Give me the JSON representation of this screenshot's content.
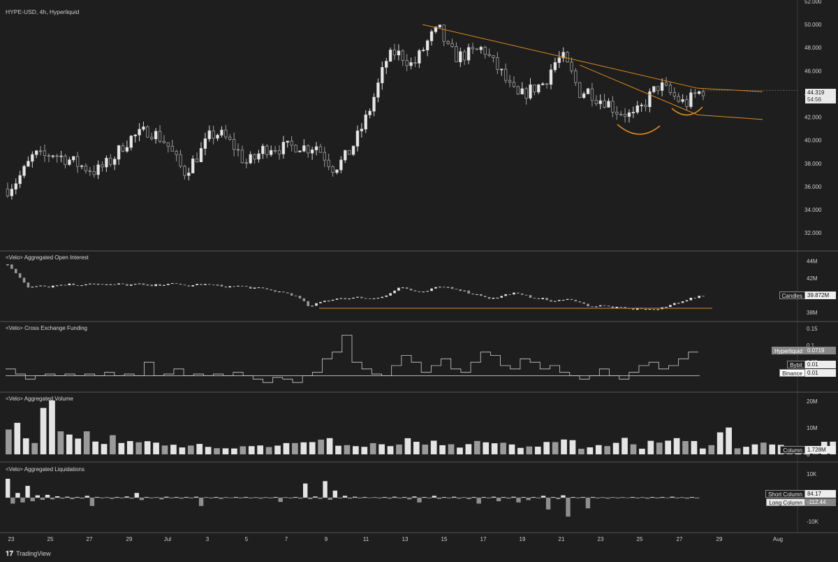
{
  "chart_data": [
    {
      "type": "candlestick",
      "title": "HYPE-USD, 4h, Hyperliquid",
      "ylim": [
        30.5,
        52
      ],
      "y_ticks": [
        "32.000",
        "34.000",
        "36.000",
        "38.000",
        "40.000",
        "42.000",
        "44.000",
        "46.000",
        "48.000",
        "50.000",
        "52.000"
      ],
      "last_price": "44.319",
      "countdown": "54:56",
      "close_path": [
        35.8,
        36.5,
        37.5,
        38.8,
        38.5,
        38.9,
        38.6,
        38.3,
        37.9,
        37.6,
        37.3,
        37.8,
        38.4,
        39.5,
        40.2,
        40.5,
        40.9,
        40.4,
        39.8,
        38.5,
        37.2,
        38.1,
        39.1,
        40.4,
        40.6,
        40.0,
        39.2,
        38.0,
        38.4,
        39.2,
        39.5,
        39.3,
        39.4,
        39.6,
        39.3,
        39.6,
        38.6,
        37.6,
        38.2,
        39.2,
        40.7,
        42.4,
        44.6,
        46.9,
        47.6,
        47.2,
        46.4,
        47.6,
        48.9,
        49.6,
        47.9,
        47.2,
        47.4,
        47.6,
        48.0,
        46.8,
        45.9,
        44.6,
        43.7,
        44.2,
        44.6,
        45.0,
        46.6,
        47.2,
        45.8,
        44.1,
        44.3,
        43.6,
        43.4,
        42.6,
        42.4,
        42.0,
        42.8,
        43.9,
        44.8,
        44.2,
        43.6,
        43.1,
        43.9,
        44.3
      ],
      "trendlines": [
        {
          "from": [
            "Jul 14",
            50.0
          ],
          "to": [
            "Jul 28",
            44.5
          ]
        },
        {
          "from": [
            "Jul 22",
            46.5
          ],
          "to": [
            "Jul 28",
            42.2
          ]
        }
      ]
    },
    {
      "type": "line",
      "title": "<Velo> Aggregated Open Interest",
      "y_ticks": [
        "38M",
        "40M",
        "42M",
        "44M"
      ],
      "ylim": [
        37.6,
        44.6
      ],
      "legend_label": "Candles",
      "legend_value": "39.872M",
      "support_level": 38.5,
      "values": [
        43.5,
        42.4,
        41.0,
        41.2,
        41.0,
        41.2,
        41.3,
        41.2,
        41.4,
        41.3,
        41.2,
        41.3,
        41.2,
        41.3,
        41.1,
        41.2,
        41.4,
        41.2,
        41.1,
        41.3,
        41.2,
        41.1,
        41.0,
        41.1,
        40.9,
        40.8,
        40.6,
        40.4,
        40.2,
        39.6,
        38.6,
        39.2,
        39.5,
        39.7,
        39.6,
        39.8,
        39.6,
        39.8,
        40.3,
        41.0,
        40.6,
        40.2,
        40.7,
        41.0,
        40.9,
        40.6,
        40.2,
        40.0,
        39.6,
        39.9,
        40.3,
        40.0,
        39.8,
        39.6,
        39.3,
        39.4,
        39.6,
        39.0,
        38.7,
        38.8,
        38.6,
        38.5,
        38.4,
        38.5,
        38.3,
        38.5,
        39.0,
        39.4,
        39.7,
        39.9
      ]
    },
    {
      "type": "step",
      "title": "<Velo> Cross Exchange Funding",
      "y_ticks": [
        "0.05",
        "0.1",
        "0.15"
      ],
      "ylim": [
        -0.02,
        0.16
      ],
      "series": [
        {
          "name": "Hyperliquid",
          "value": "0.0719",
          "values": [
            0.02,
            0.005,
            -0.01,
            0.0,
            0.005,
            0.0,
            0.005,
            0.0,
            0.005,
            0.0,
            0.01,
            0.0,
            0.005,
            0.0,
            0.04,
            0.0,
            0.005,
            0.02,
            0.0,
            0.005,
            0.0,
            0.005,
            0.0,
            0.01,
            0.0,
            -0.01,
            -0.02,
            -0.005,
            -0.01,
            -0.02,
            0.0,
            0.01,
            0.05,
            0.07,
            0.12,
            0.04,
            0.02,
            0.005,
            0.0,
            0.03,
            0.06,
            0.04,
            0.01,
            0.03,
            0.05,
            0.02,
            0.01,
            0.04,
            0.07,
            0.06,
            0.03,
            0.02,
            0.05,
            0.04,
            0.02,
            0.03,
            0.01,
            0.0,
            -0.01,
            0.0,
            0.02,
            0.0,
            -0.01,
            0.01,
            0.03,
            0.04,
            0.02,
            0.03,
            0.05,
            0.07
          ]
        },
        {
          "name": "Bybit",
          "value": "0.01"
        },
        {
          "name": "Binance",
          "value": "0.01"
        }
      ]
    },
    {
      "type": "bar",
      "title": "<Velo> Aggregated Volume",
      "y_ticks": [
        "0",
        "10M",
        "20M"
      ],
      "ylim": [
        0,
        21
      ],
      "legend_label": "Column",
      "legend_value": "1.728M",
      "values": [
        12,
        6,
        17,
        9,
        8,
        5,
        6,
        4,
        4,
        3,
        3,
        4,
        3,
        3,
        4,
        3,
        5,
        4,
        5,
        4,
        3,
        4,
        3,
        5,
        4,
        3,
        3,
        4,
        4,
        3,
        3,
        4,
        5,
        3,
        3,
        6,
        3,
        4,
        5,
        4,
        3,
        9,
        3,
        5,
        4,
        3,
        3,
        4,
        3,
        4,
        3,
        4,
        5,
        5,
        7,
        5,
        10,
        5,
        4,
        4,
        3,
        3,
        4,
        9,
        6,
        5,
        4,
        4,
        6,
        7,
        4,
        3,
        4,
        3,
        3,
        4,
        3,
        2,
        2,
        3
      ]
    },
    {
      "type": "bar",
      "title": "<Velo> Aggregated Liquidations",
      "y_ticks": [
        "10K",
        "-10K"
      ],
      "ylim": [
        -13000,
        13000
      ],
      "series": [
        {
          "name": "Short Column",
          "value": "84.17",
          "values": [
            8000,
            2000,
            5000,
            1000,
            1200,
            600,
            400,
            300,
            800,
            300,
            200,
            300,
            500,
            2000,
            300,
            200,
            400,
            300,
            300,
            400,
            200,
            300,
            200,
            300,
            300,
            200,
            200,
            300,
            200,
            300,
            6000,
            500,
            7000,
            3000,
            800,
            400,
            300,
            200,
            300,
            400,
            300,
            500,
            300,
            800,
            300,
            400,
            200,
            300,
            300,
            400,
            300,
            400,
            300,
            300,
            800,
            300,
            1000,
            300,
            300,
            300,
            200,
            200,
            200,
            300,
            200,
            300,
            300,
            400,
            200,
            300
          ]
        },
        {
          "name": "Long Column",
          "value": "-112.44",
          "values": [
            -2500,
            -2000,
            -1500,
            -900,
            -700,
            -400,
            -600,
            -400,
            -3500,
            -300,
            -500,
            -300,
            -400,
            -1000,
            -300,
            -700,
            -300,
            -400,
            -300,
            -3500,
            -300,
            -500,
            -200,
            -300,
            -300,
            -400,
            -300,
            -1800,
            -300,
            -400,
            -600,
            -500,
            -900,
            -300,
            -400,
            -300,
            -200,
            -300,
            -400,
            -300,
            -700,
            -2000,
            -300,
            -500,
            -300,
            -400,
            -600,
            -2500,
            -300,
            -1500,
            -400,
            -2000,
            -1000,
            -300,
            -5000,
            -600,
            -8000,
            -300,
            -4500,
            -300,
            -400,
            -300,
            -200,
            -300,
            -400,
            -300,
            -200,
            -300,
            -400,
            -300
          ]
        }
      ]
    }
  ],
  "x_axis": {
    "labels": [
      "23",
      "25",
      "27",
      "29",
      "Jul",
      "3",
      "5",
      "7",
      "9",
      "11",
      "13",
      "15",
      "17",
      "19",
      "21",
      "23",
      "25",
      "27",
      "29",
      "Aug"
    ]
  },
  "footer": {
    "brand": "TradingView"
  },
  "colors": {
    "background": "#1e1e1e",
    "candle_up": "#d9d9d9",
    "candle_down": "#a0a0a0",
    "trendline": "#e08a1e",
    "grid": "#2a2a2a"
  }
}
